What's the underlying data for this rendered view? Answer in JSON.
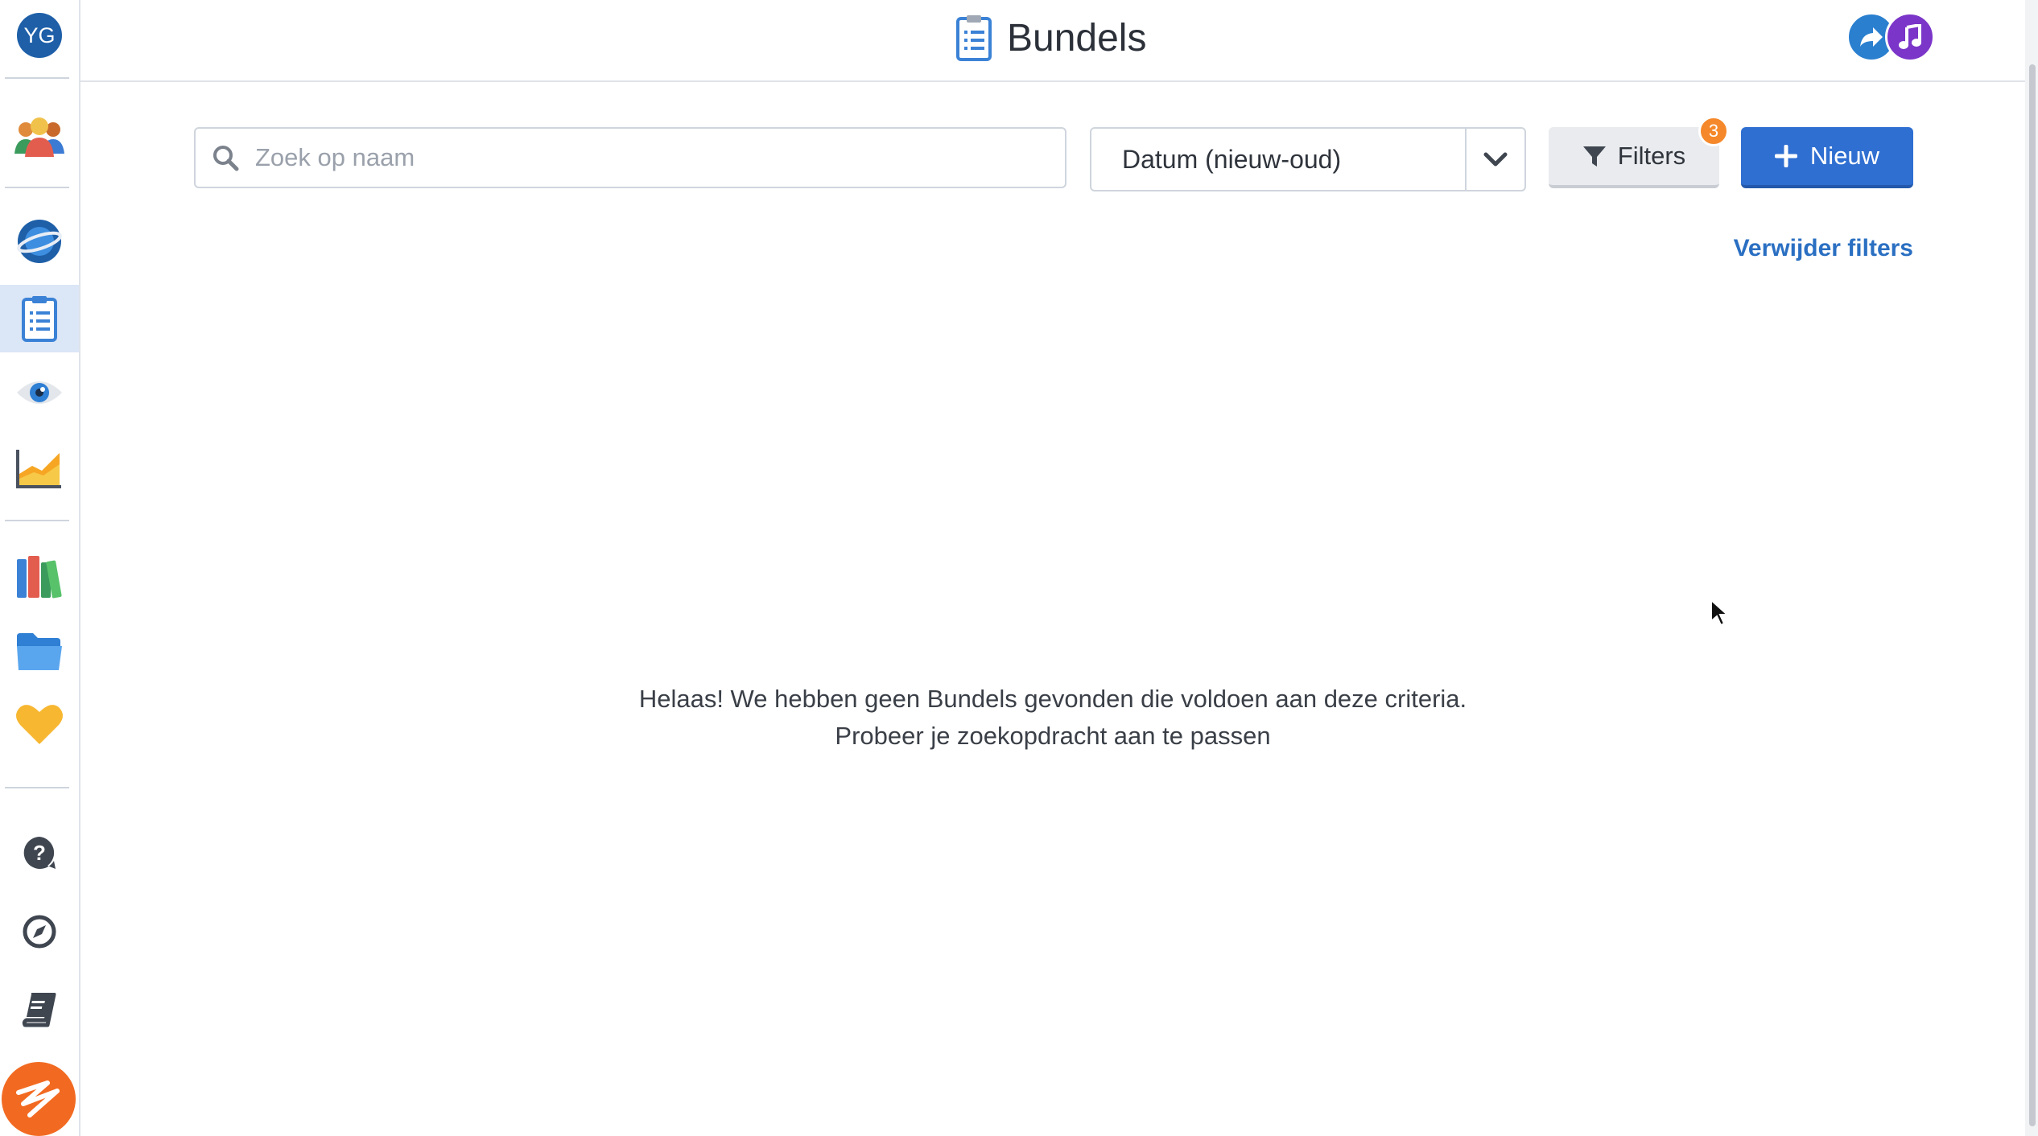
{
  "sidebar": {
    "avatar_initials": "YG",
    "items": [
      {
        "name": "users-icon"
      },
      {
        "name": "planet-icon"
      },
      {
        "name": "clipboard-list-icon",
        "active": true
      },
      {
        "name": "eye-icon"
      },
      {
        "name": "area-chart-icon"
      },
      {
        "name": "books-icon"
      },
      {
        "name": "folder-icon"
      },
      {
        "name": "heart-icon"
      },
      {
        "name": "help-icon"
      },
      {
        "name": "compass-icon"
      },
      {
        "name": "book-icon"
      },
      {
        "name": "brand-logo-icon"
      }
    ]
  },
  "header": {
    "title": "Bundels",
    "title_icon": "clipboard-list-icon",
    "avatars": [
      {
        "icon": "share-icon",
        "color": "#2a7fcf"
      },
      {
        "icon": "music-note-icon",
        "color": "#7b35c8"
      }
    ]
  },
  "toolbar": {
    "search_placeholder": "Zoek op naam",
    "sort_value": "Datum (nieuw-oud)",
    "filters_label": "Filters",
    "filters_count": "3",
    "new_label": "Nieuw",
    "clear_filters_label": "Verwijder filters"
  },
  "empty_state": {
    "line1": "Helaas! We hebben geen Bundels gevonden die voldoen aan deze criteria.",
    "line2": "Probeer je zoekopdracht aan te passen"
  },
  "colors": {
    "primary": "#2f6fd1",
    "link": "#2a6fc2",
    "badge": "#f5882a",
    "sidebar_active": "#dbe6f6",
    "brand": "#f26a21"
  }
}
